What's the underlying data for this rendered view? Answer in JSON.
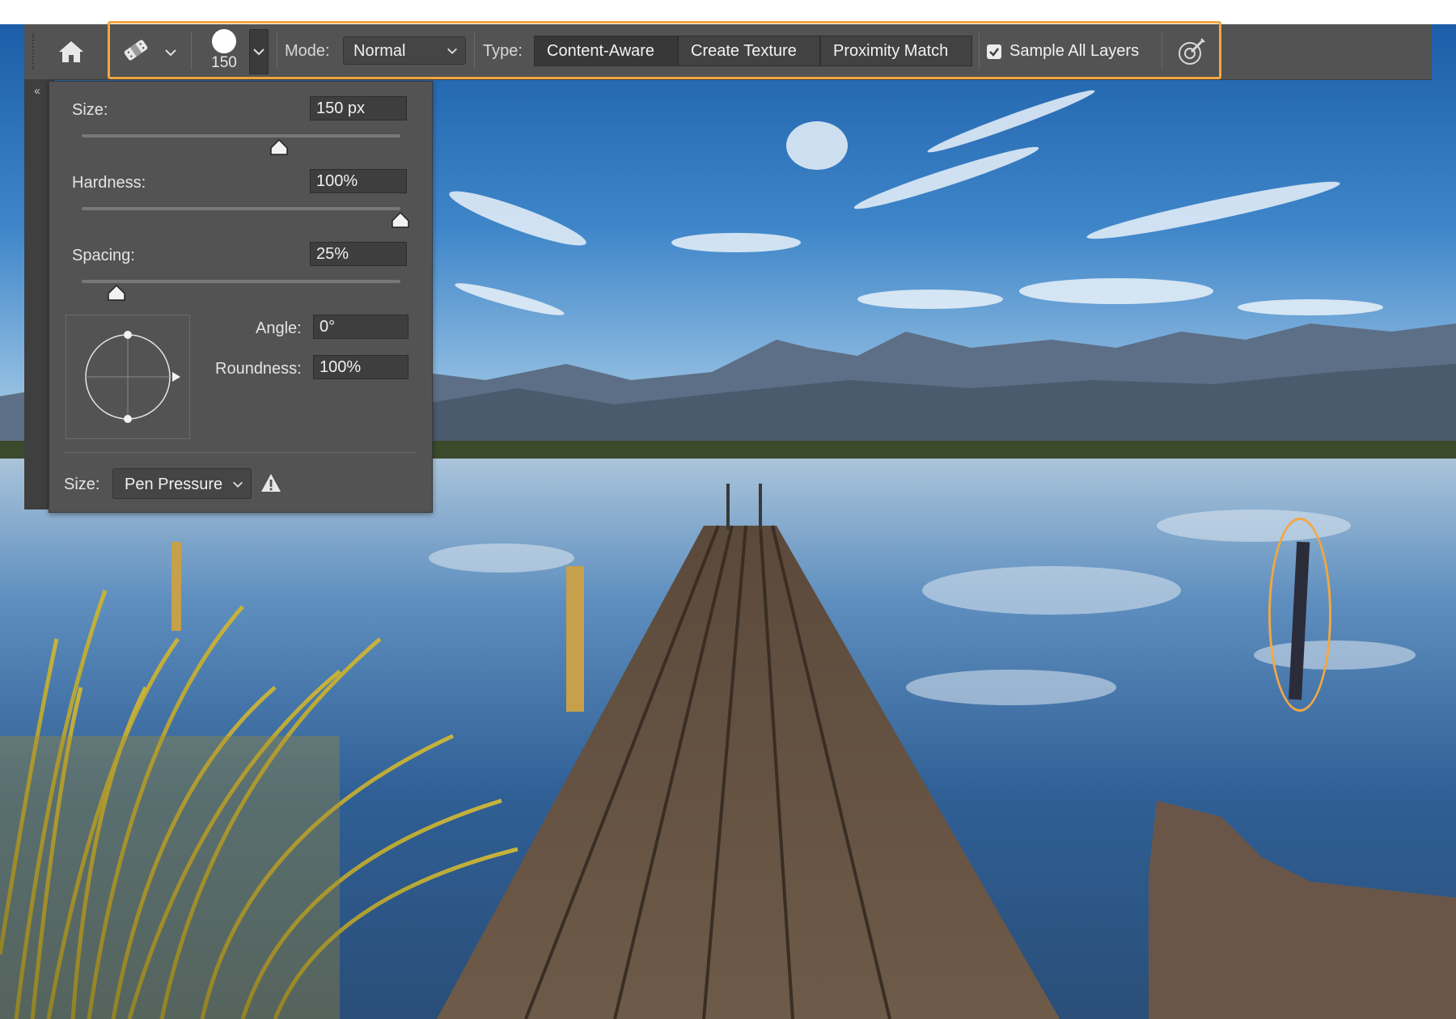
{
  "options_bar": {
    "brush_size": "150",
    "mode_label": "Mode:",
    "mode_value": "Normal",
    "type_label": "Type:",
    "type_options": [
      "Content-Aware",
      "Create Texture",
      "Proximity Match"
    ],
    "type_selected": "Content-Aware",
    "sample_all_layers_label": "Sample All Layers",
    "sample_all_layers_checked": true,
    "icons": [
      "home-icon",
      "spot-healing-brush-icon",
      "chevron-down-icon",
      "pressure-size-icon"
    ]
  },
  "brush_panel": {
    "size_label": "Size:",
    "size_value": "150 px",
    "size_slider": 0.62,
    "hardness_label": "Hardness:",
    "hardness_value": "100%",
    "hardness_slider": 1.0,
    "spacing_label": "Spacing:",
    "spacing_value": "25%",
    "spacing_slider": 0.11,
    "angle_label": "Angle:",
    "angle_value": "0°",
    "roundness_label": "Roundness:",
    "roundness_value": "100%",
    "dynamics_label": "Size:",
    "dynamics_value": "Pen Pressure",
    "icons": [
      "angle-roundness-control",
      "warning-icon"
    ]
  },
  "colors": {
    "highlight": "#f2a742",
    "ui_background": "#535353",
    "field_background": "#3e3e3e"
  }
}
